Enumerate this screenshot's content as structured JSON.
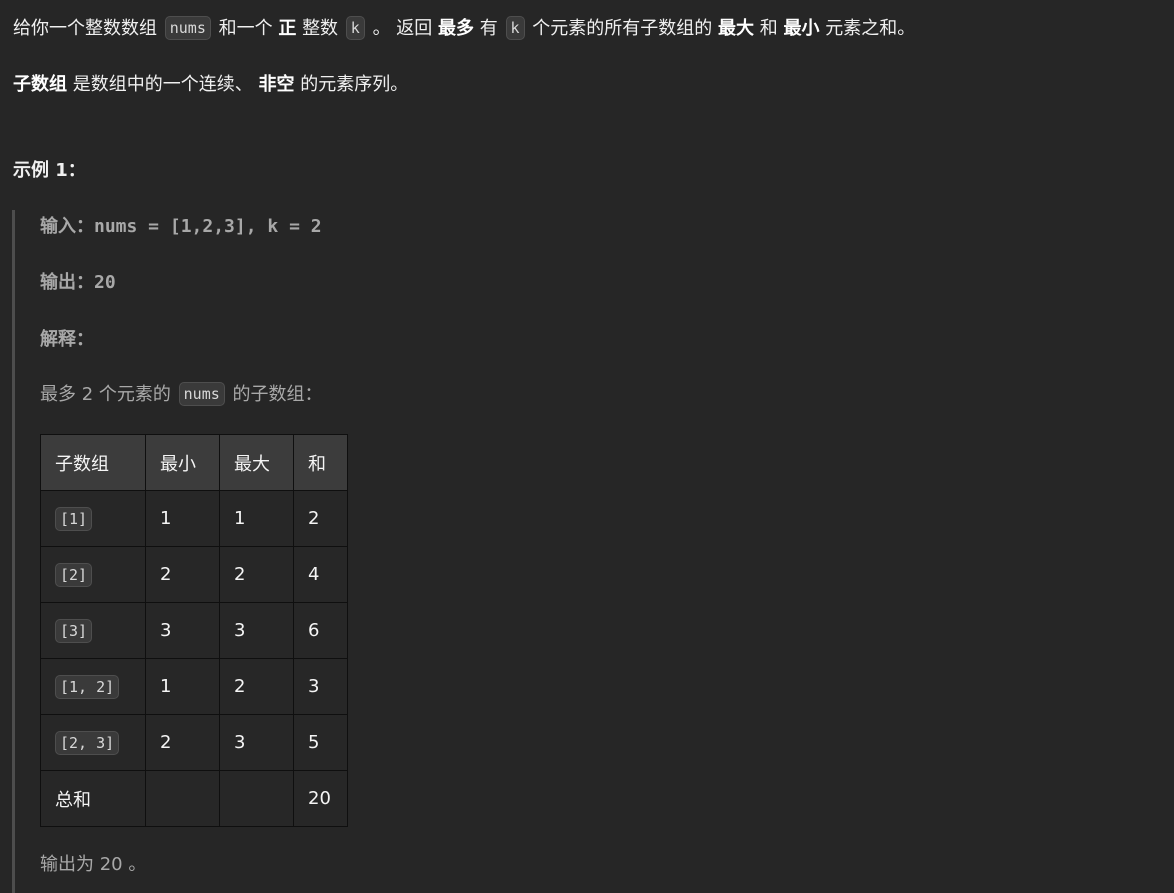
{
  "intro": {
    "p1_a": "给你一个整数数组",
    "p1_code1": "nums",
    "p1_b": "和一个",
    "p1_bold1": "正",
    "p1_c": "整数",
    "p1_code2": "k",
    "p1_d": "。 返回",
    "p1_bold2": "最多",
    "p1_e": "有",
    "p1_code3": "k",
    "p1_f": "个元素的所有子数组的",
    "p1_bold3": "最大",
    "p1_g": "和",
    "p1_bold4": "最小",
    "p1_h": "元素之和。",
    "p2_bold1": "子数组",
    "p2_a": "是数组中的一个连续、",
    "p2_bold2": "非空",
    "p2_b": "的元素序列。"
  },
  "example": {
    "title": "示例 1：",
    "input_label": "输入：",
    "input_value": "nums = [1,2,3], k = 2",
    "output_label": "输出：",
    "output_value": "20",
    "explain_label": "解释：",
    "desc_a": "最多 2 个元素的",
    "desc_code": "nums",
    "desc_b": "的子数组：",
    "final": "输出为 20 。"
  },
  "table": {
    "headers": [
      "子数组",
      "最小",
      "最大",
      "和"
    ],
    "rows": [
      [
        "[1]",
        "1",
        "1",
        "2"
      ],
      [
        "[2]",
        "2",
        "2",
        "4"
      ],
      [
        "[3]",
        "3",
        "3",
        "6"
      ],
      [
        "[1, 2]",
        "1",
        "2",
        "3"
      ],
      [
        "[2, 3]",
        "2",
        "3",
        "5"
      ]
    ],
    "total": [
      "总和",
      "",
      "",
      "20"
    ]
  }
}
